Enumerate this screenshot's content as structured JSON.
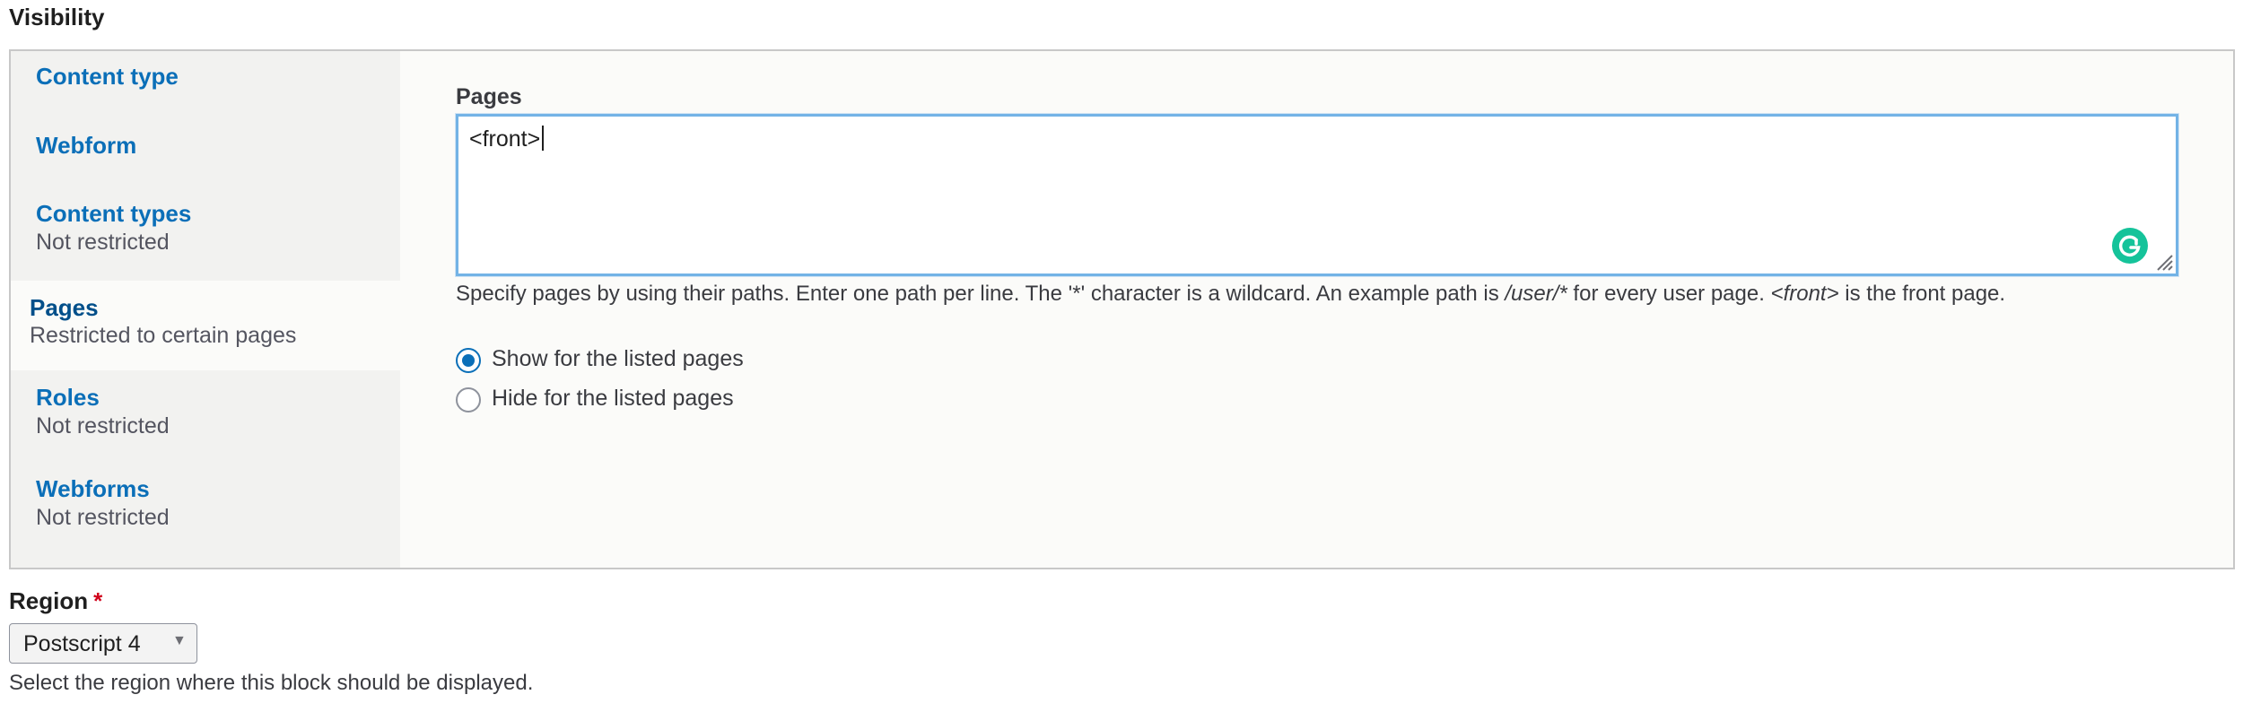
{
  "visibility": {
    "title": "Visibility",
    "tabs": [
      {
        "label": "Content type",
        "summary": ""
      },
      {
        "label": "Webform",
        "summary": ""
      },
      {
        "label": "Content types",
        "summary": "Not restricted"
      },
      {
        "label": "Pages",
        "summary": "Restricted to certain pages",
        "selected": true
      },
      {
        "label": "Roles",
        "summary": "Not restricted"
      },
      {
        "label": "Webforms",
        "summary": "Not restricted"
      }
    ],
    "pages_pane": {
      "field_label": "Pages",
      "textarea_value": "<front>",
      "help": {
        "part1": "Specify pages by using their paths. Enter one path per line. The '*' character is a wildcard. An example path is ",
        "example_path": "/user/*",
        "part2": " for every user page. ",
        "front_token": "<front>",
        "part3": " is the front page."
      },
      "radio_options": [
        {
          "label": "Show for the listed pages",
          "checked": true
        },
        {
          "label": "Hide for the listed pages",
          "checked": false
        }
      ]
    }
  },
  "region": {
    "label": "Region",
    "required_marker": "*",
    "selected_value": "Postscript 4",
    "arrow_glyph": "▼",
    "help": "Select the region where this block should be displayed."
  },
  "colors": {
    "link": "#0b6fb8",
    "selected_link": "#004f8a",
    "focus_border": "#73b3e6",
    "required": "#d0021b",
    "grammarly": "#15c39a"
  },
  "icons": {
    "grammarly": "grammarly-icon",
    "resize": "resize-handle-icon",
    "select_arrow": "chevron-down-icon"
  }
}
